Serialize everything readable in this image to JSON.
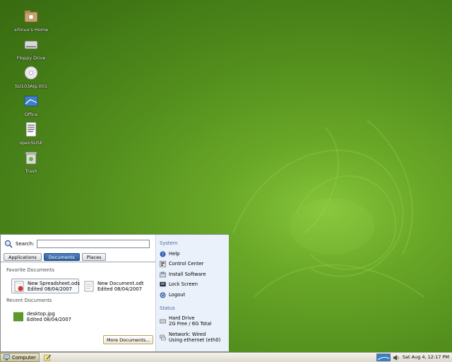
{
  "desktop": {
    "icons": [
      {
        "name": "home",
        "label": "srlinux's Home"
      },
      {
        "name": "floppy",
        "label": "Floppy Drive"
      },
      {
        "name": "cd",
        "label": "SU103Alp.001"
      },
      {
        "name": "office",
        "label": "Office"
      },
      {
        "name": "opensuse",
        "label": "openSUSE"
      },
      {
        "name": "trash",
        "label": "Trash"
      }
    ]
  },
  "menu": {
    "search_label": "Search:",
    "search_value": "",
    "tabs": [
      "Applications",
      "Documents",
      "Places"
    ],
    "active_tab": "Documents",
    "favorite_header": "Favorite Documents",
    "favorites": [
      {
        "name": "New Spreadsheet.ods",
        "edited": "Edited 08/04/2007",
        "icon": "spreadsheet-icon"
      },
      {
        "name": "New Document.odt",
        "edited": "Edited 08/04/2007",
        "icon": "document-icon"
      }
    ],
    "recent_header": "Recent Documents",
    "recent": [
      {
        "name": "desktop.jpg",
        "edited": "Edited 08/04/2007",
        "icon": "image-icon"
      }
    ],
    "more_button": "More Documents...",
    "system_header": "System",
    "system_items": [
      {
        "label": "Help",
        "icon": "help-icon"
      },
      {
        "label": "Control Center",
        "icon": "control-center-icon"
      },
      {
        "label": "Install Software",
        "icon": "install-software-icon"
      },
      {
        "label": "Lock Screen",
        "icon": "lock-screen-icon"
      },
      {
        "label": "Logout",
        "icon": "logout-icon"
      }
    ],
    "status_header": "Status",
    "status_items": [
      {
        "title": "Hard Drive",
        "detail": "2G Free / 6G Total",
        "icon": "hard-drive-icon"
      },
      {
        "title": "Network: Wired",
        "detail": "Using ethernet (eth0)",
        "icon": "network-icon"
      }
    ]
  },
  "taskbar": {
    "computer_label": "Computer",
    "clock": "Sat Aug 4, 12:17 PM"
  },
  "colors": {
    "desktop_green": "#55911e",
    "menu_active_tab": "#3a6aa8",
    "system_panel": "#eaf1fb"
  }
}
